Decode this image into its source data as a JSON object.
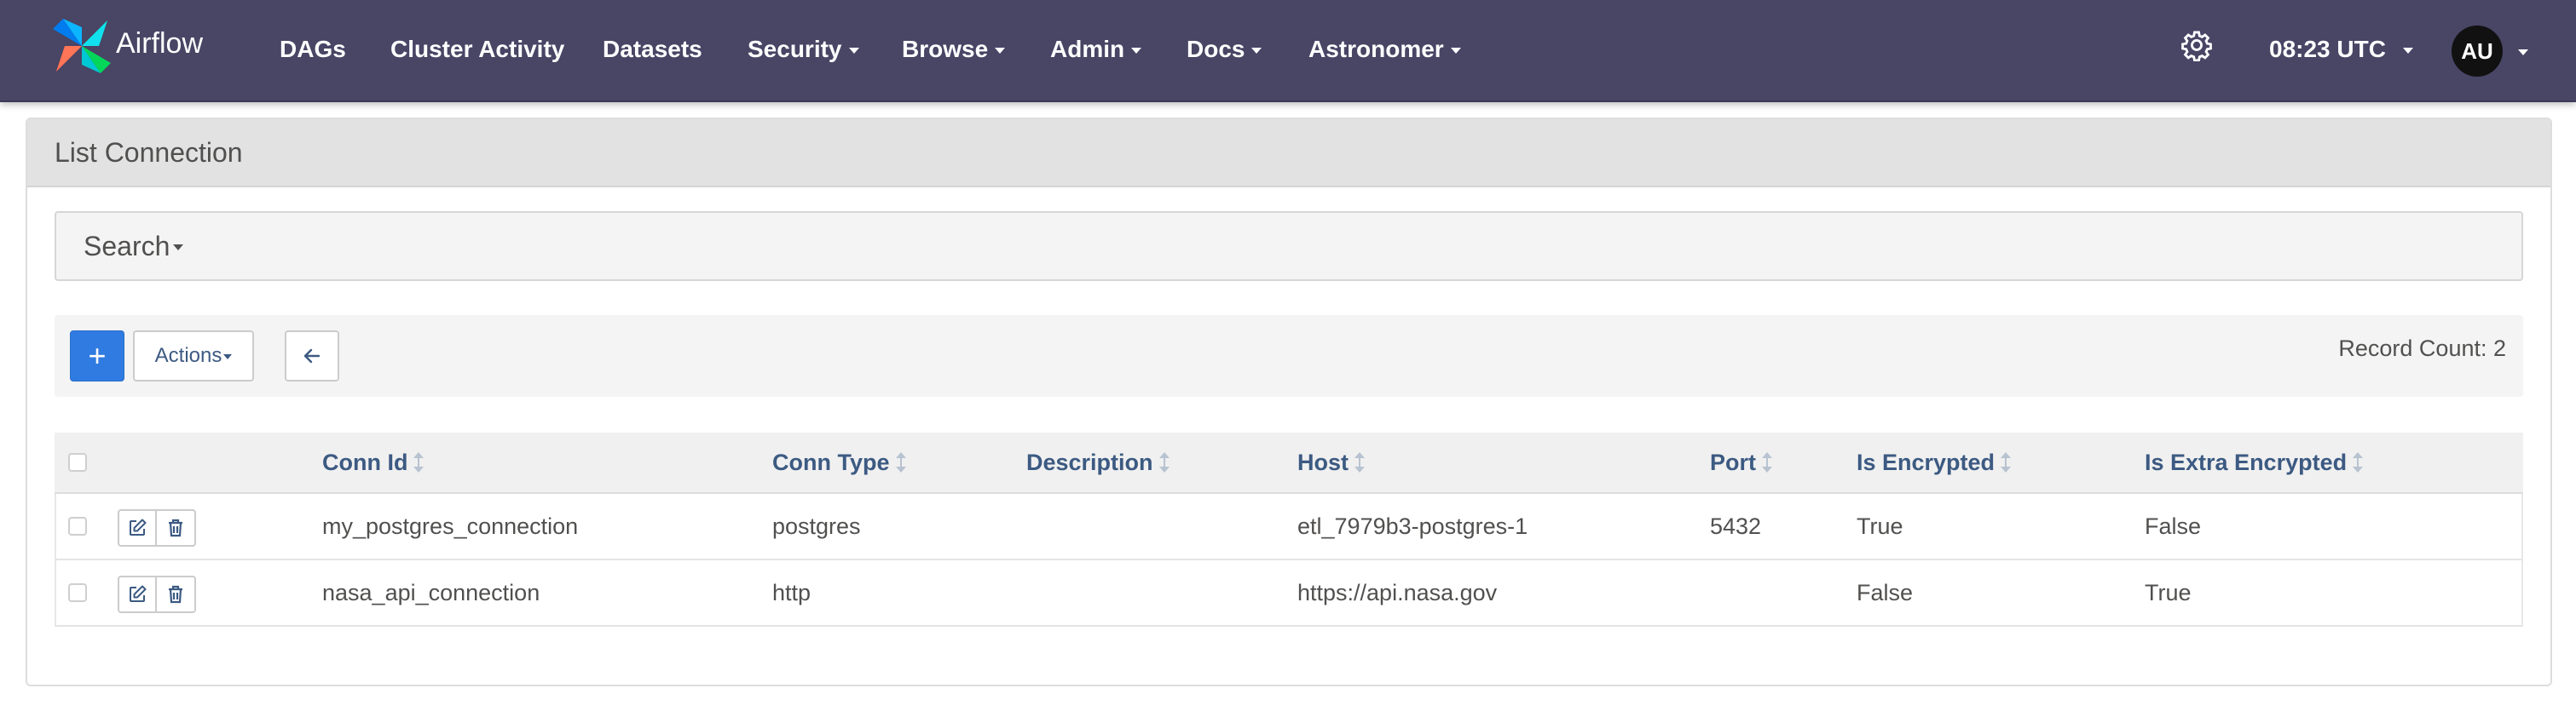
{
  "navbar": {
    "brand": "Airflow",
    "items": [
      {
        "label": "DAGs",
        "dropdown": false
      },
      {
        "label": "Cluster Activity",
        "dropdown": false
      },
      {
        "label": "Datasets",
        "dropdown": false
      },
      {
        "label": "Security",
        "dropdown": true
      },
      {
        "label": "Browse",
        "dropdown": true
      },
      {
        "label": "Admin",
        "dropdown": true
      },
      {
        "label": "Docs",
        "dropdown": true
      },
      {
        "label": "Astronomer",
        "dropdown": true
      }
    ],
    "time": "08:23 UTC",
    "avatar": "AU",
    "settings_icon": "gear-icon"
  },
  "panel": {
    "title": "List Connection",
    "search_label": "Search",
    "add_icon": "+",
    "actions_label": "Actions",
    "back_icon": "arrow-left-icon",
    "record_count": "Record Count: 2"
  },
  "table": {
    "columns": [
      "Conn Id",
      "Conn Type",
      "Description",
      "Host",
      "Port",
      "Is Encrypted",
      "Is Extra Encrypted"
    ],
    "rows": [
      {
        "conn_id": "my_postgres_connection",
        "conn_type": "postgres",
        "description": "",
        "host": "etl_7979b3-postgres-1",
        "port": "5432",
        "is_encrypted": "True",
        "is_extra_encrypted": "False"
      },
      {
        "conn_id": "nasa_api_connection",
        "conn_type": "http",
        "description": "",
        "host": "https://api.nasa.gov",
        "port": "",
        "is_encrypted": "False",
        "is_extra_encrypted": "True"
      }
    ]
  },
  "colors": {
    "navbar_bg": "#484565",
    "primary_button": "#2f7be1",
    "link_text": "#3c5a82"
  }
}
